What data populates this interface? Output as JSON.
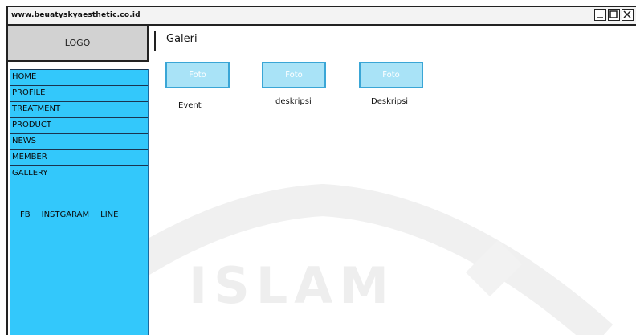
{
  "window": {
    "url": "www.beuatyskyaesthetic.co.id"
  },
  "sidebar": {
    "logo": "LOGO",
    "items": [
      {
        "label": "HOME"
      },
      {
        "label": "PROFILE"
      },
      {
        "label": "TREATMENT"
      },
      {
        "label": "PRODUCT"
      },
      {
        "label": "NEWS"
      },
      {
        "label": "MEMBER"
      },
      {
        "label": "GALLERY"
      }
    ],
    "social": [
      "FB",
      "INSTGARAM",
      "LINE"
    ]
  },
  "main": {
    "title": "Galeri",
    "photos": [
      {
        "label": "Foto",
        "caption": "Event"
      },
      {
        "label": "Foto",
        "caption": "deskripsi"
      },
      {
        "label": "Foto",
        "caption": "Deskripsi"
      }
    ]
  },
  "watermark": {
    "text": "ISLAM"
  },
  "colors": {
    "nav": "#33c8fb",
    "photo_fill": "#a9e3f7",
    "photo_border": "#3aa6d6"
  }
}
